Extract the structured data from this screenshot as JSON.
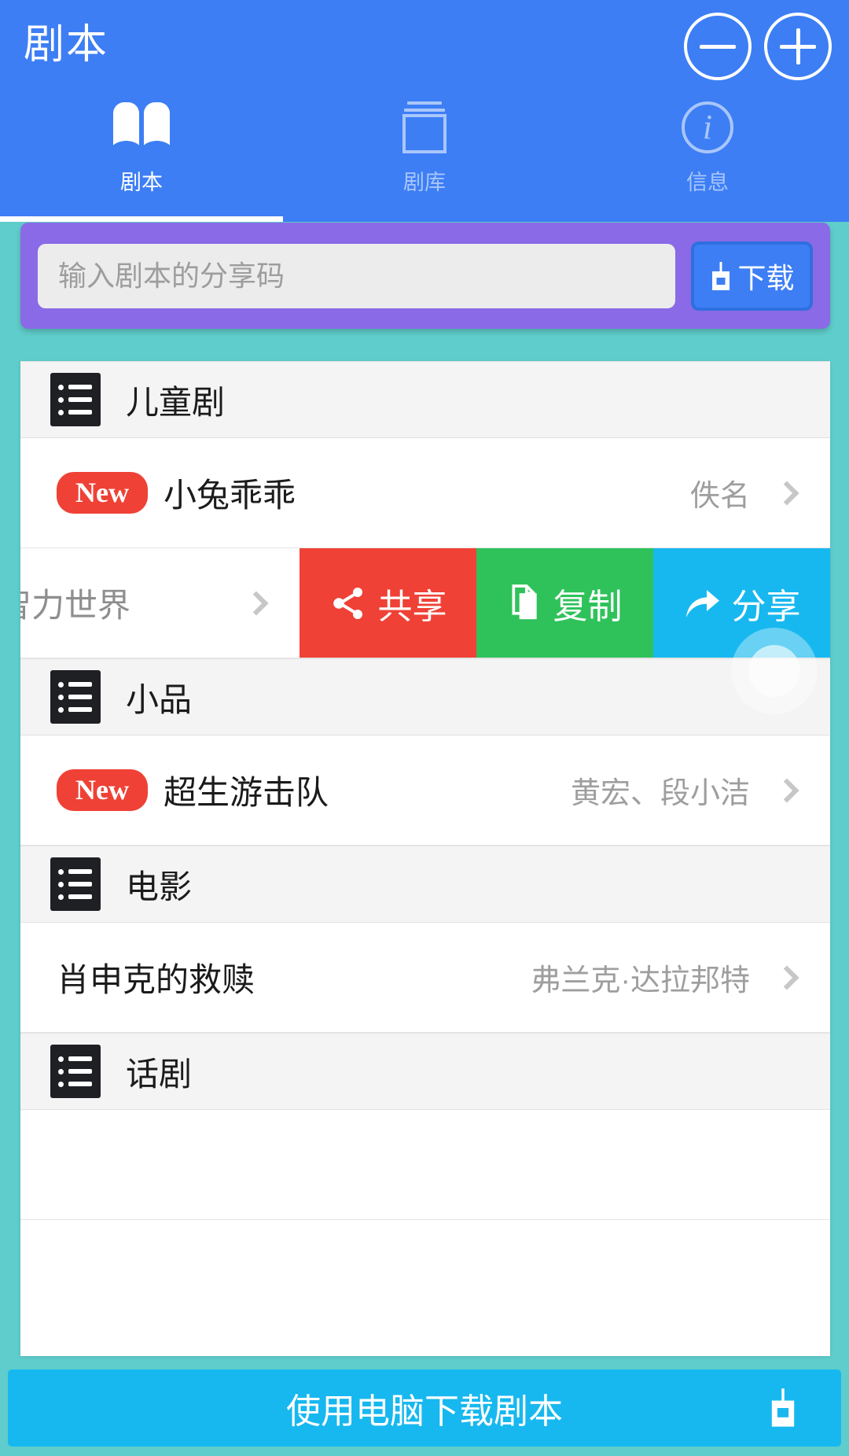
{
  "header": {
    "title": "剧本",
    "buttons": [
      {
        "name": "minus-button",
        "glyph": "−"
      },
      {
        "name": "plus-button",
        "glyph": "+"
      }
    ]
  },
  "tabs": [
    {
      "label": "剧本",
      "icon": "book-icon",
      "active": true
    },
    {
      "label": "剧库",
      "icon": "library-icon",
      "active": false
    },
    {
      "label": "信息",
      "icon": "info-icon",
      "active": false
    }
  ],
  "share_code": {
    "placeholder": "输入剧本的分享码",
    "value": "",
    "download_label": "下载"
  },
  "list": [
    {
      "type": "section",
      "title": "儿童剧"
    },
    {
      "type": "row",
      "badge": "New",
      "title": "小兔乖乖",
      "author": "佚名",
      "swiped": false
    },
    {
      "type": "row",
      "badge": "",
      "title": "智力世界",
      "author": "",
      "swiped": true,
      "actions": [
        {
          "label": "共享",
          "icon": "share-nodes-icon",
          "color": "#ef4136"
        },
        {
          "label": "复制",
          "icon": "copy-icon",
          "color": "#2fc25b"
        },
        {
          "label": "分享",
          "icon": "forward-arrow-icon",
          "color": "#17b8ef"
        }
      ]
    },
    {
      "type": "section",
      "title": "小品"
    },
    {
      "type": "row",
      "badge": "New",
      "title": "超生游击队",
      "author": "黄宏、段小洁",
      "swiped": false
    },
    {
      "type": "section",
      "title": "电影"
    },
    {
      "type": "row",
      "badge": "",
      "title": "肖申克的救赎",
      "author": "弗兰克·达拉邦特",
      "swiped": false
    },
    {
      "type": "section",
      "title": "话剧"
    }
  ],
  "bottom_bar": {
    "label": "使用电脑下载剧本",
    "icon": "download-tray-icon"
  },
  "colors": {
    "header_blue": "#3d7ef5",
    "page_teal": "#5fcdcb",
    "card_purple": "#8a6ae6",
    "accent_red": "#ef4136",
    "accent_green": "#2fc25b",
    "accent_cyan": "#17b8ef"
  }
}
